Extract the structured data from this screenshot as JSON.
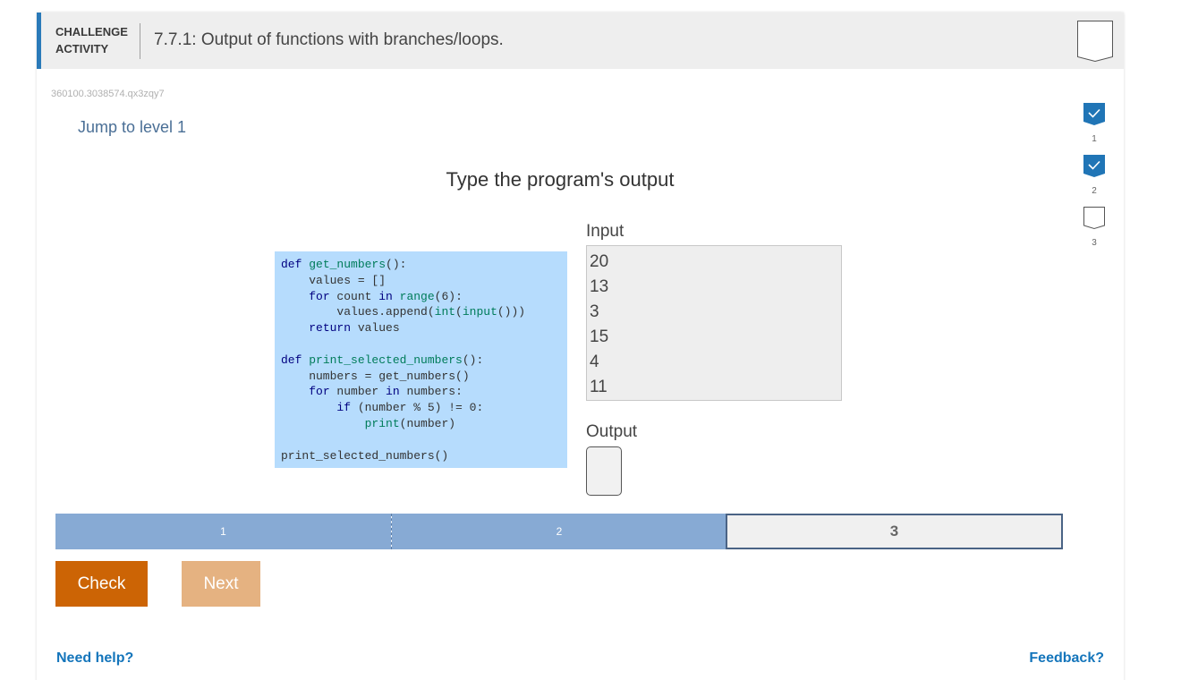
{
  "header": {
    "label_line1": "CHALLENGE",
    "label_line2": "ACTIVITY",
    "title": "7.7.1: Output of functions with branches/loops."
  },
  "activity_id": "360100.3038574.qx3zqy7",
  "jump_link": "Jump to level 1",
  "levels": [
    {
      "number": "1",
      "status": "completed"
    },
    {
      "number": "2",
      "status": "completed"
    },
    {
      "number": "3",
      "status": "incomplete"
    }
  ],
  "instructions": "Type the program's output",
  "code": {
    "lines": [
      [
        {
          "t": "def ",
          "c": "kw"
        },
        {
          "t": "get_numbers",
          "c": "fn"
        },
        {
          "t": "():",
          "c": ""
        }
      ],
      [
        {
          "t": "    values = []",
          "c": ""
        }
      ],
      [
        {
          "t": "    ",
          "c": ""
        },
        {
          "t": "for",
          "c": "kw"
        },
        {
          "t": " count ",
          "c": ""
        },
        {
          "t": "in",
          "c": "kw"
        },
        {
          "t": " ",
          "c": ""
        },
        {
          "t": "range",
          "c": "fn"
        },
        {
          "t": "(6):",
          "c": ""
        }
      ],
      [
        {
          "t": "        values.append(",
          "c": ""
        },
        {
          "t": "int",
          "c": "fn"
        },
        {
          "t": "(",
          "c": ""
        },
        {
          "t": "input",
          "c": "fn"
        },
        {
          "t": "()))",
          "c": ""
        }
      ],
      [
        {
          "t": "    ",
          "c": ""
        },
        {
          "t": "return",
          "c": "kw"
        },
        {
          "t": " values",
          "c": ""
        }
      ],
      [
        {
          "t": "",
          "c": ""
        }
      ],
      [
        {
          "t": "def ",
          "c": "kw"
        },
        {
          "t": "print_selected_numbers",
          "c": "fn"
        },
        {
          "t": "():",
          "c": ""
        }
      ],
      [
        {
          "t": "    numbers = get_numbers()",
          "c": ""
        }
      ],
      [
        {
          "t": "    ",
          "c": ""
        },
        {
          "t": "for",
          "c": "kw"
        },
        {
          "t": " number ",
          "c": ""
        },
        {
          "t": "in",
          "c": "kw"
        },
        {
          "t": " numbers:",
          "c": ""
        }
      ],
      [
        {
          "t": "        ",
          "c": ""
        },
        {
          "t": "if",
          "c": "kw"
        },
        {
          "t": " (number % 5) != 0:",
          "c": ""
        }
      ],
      [
        {
          "t": "            ",
          "c": ""
        },
        {
          "t": "print",
          "c": "fn"
        },
        {
          "t": "(number)",
          "c": ""
        }
      ],
      [
        {
          "t": "",
          "c": ""
        }
      ],
      [
        {
          "t": "print_selected_numbers()",
          "c": ""
        }
      ]
    ]
  },
  "input": {
    "label": "Input",
    "values": [
      "20",
      "13",
      "3",
      "15",
      "4",
      "11"
    ]
  },
  "output": {
    "label": "Output",
    "value": ""
  },
  "progress": {
    "segments": [
      "1",
      "2",
      "3"
    ],
    "current": 3
  },
  "buttons": {
    "check": "Check",
    "next": "Next"
  },
  "footer": {
    "help": "Need help?",
    "feedback": "Feedback?"
  },
  "colors": {
    "accent": "#2a7ab9",
    "check_button": "#cc6405",
    "next_button_disabled": "#e5b281",
    "code_background": "#b6dcfd",
    "progress_done": "#87aad4",
    "link": "#1475bb"
  }
}
